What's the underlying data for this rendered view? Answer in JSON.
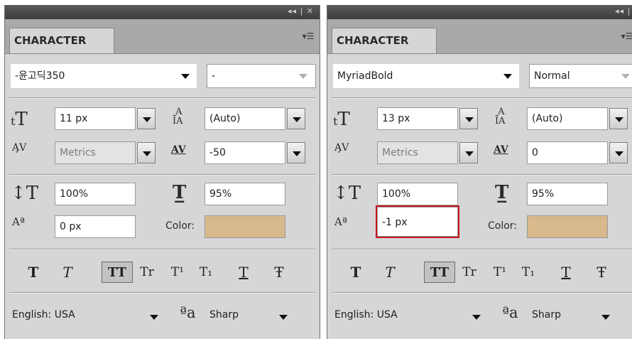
{
  "panels": [
    {
      "tab_label": "CHARACTER",
      "title_controls": "◂◂ | ✕",
      "font_family": "-윤고딕350",
      "font_style": "-",
      "font_size": "11 px",
      "leading": "(Auto)",
      "kerning": "Metrics",
      "tracking": "-50",
      "vertical_scale": "100%",
      "horizontal_scale": "95%",
      "baseline_shift": "0 px",
      "color_label": "Color:",
      "color": "#d8b98c",
      "style_buttons": [
        "T",
        "T",
        "TT",
        "Tr",
        "T¹",
        "T₁",
        "T",
        "Ŧ"
      ],
      "language": "English: USA",
      "aa_icon": "ªa",
      "antialias": "Sharp"
    },
    {
      "tab_label": "CHARACTER",
      "title_controls": "◂◂ | ✕",
      "font_family": "MyriadBold",
      "font_style": "Normal",
      "font_size": "13 px",
      "leading": "(Auto)",
      "kerning": "Metrics",
      "tracking": "0",
      "vertical_scale": "100%",
      "horizontal_scale": "95%",
      "baseline_shift": "-1 px",
      "color_label": "Color:",
      "color": "#d8b98c",
      "style_buttons": [
        "T",
        "T",
        "TT",
        "Tr",
        "T¹",
        "T₁",
        "T",
        "Ŧ"
      ],
      "language": "English: USA",
      "aa_icon": "ªa",
      "antialias": "Sharp"
    }
  ]
}
